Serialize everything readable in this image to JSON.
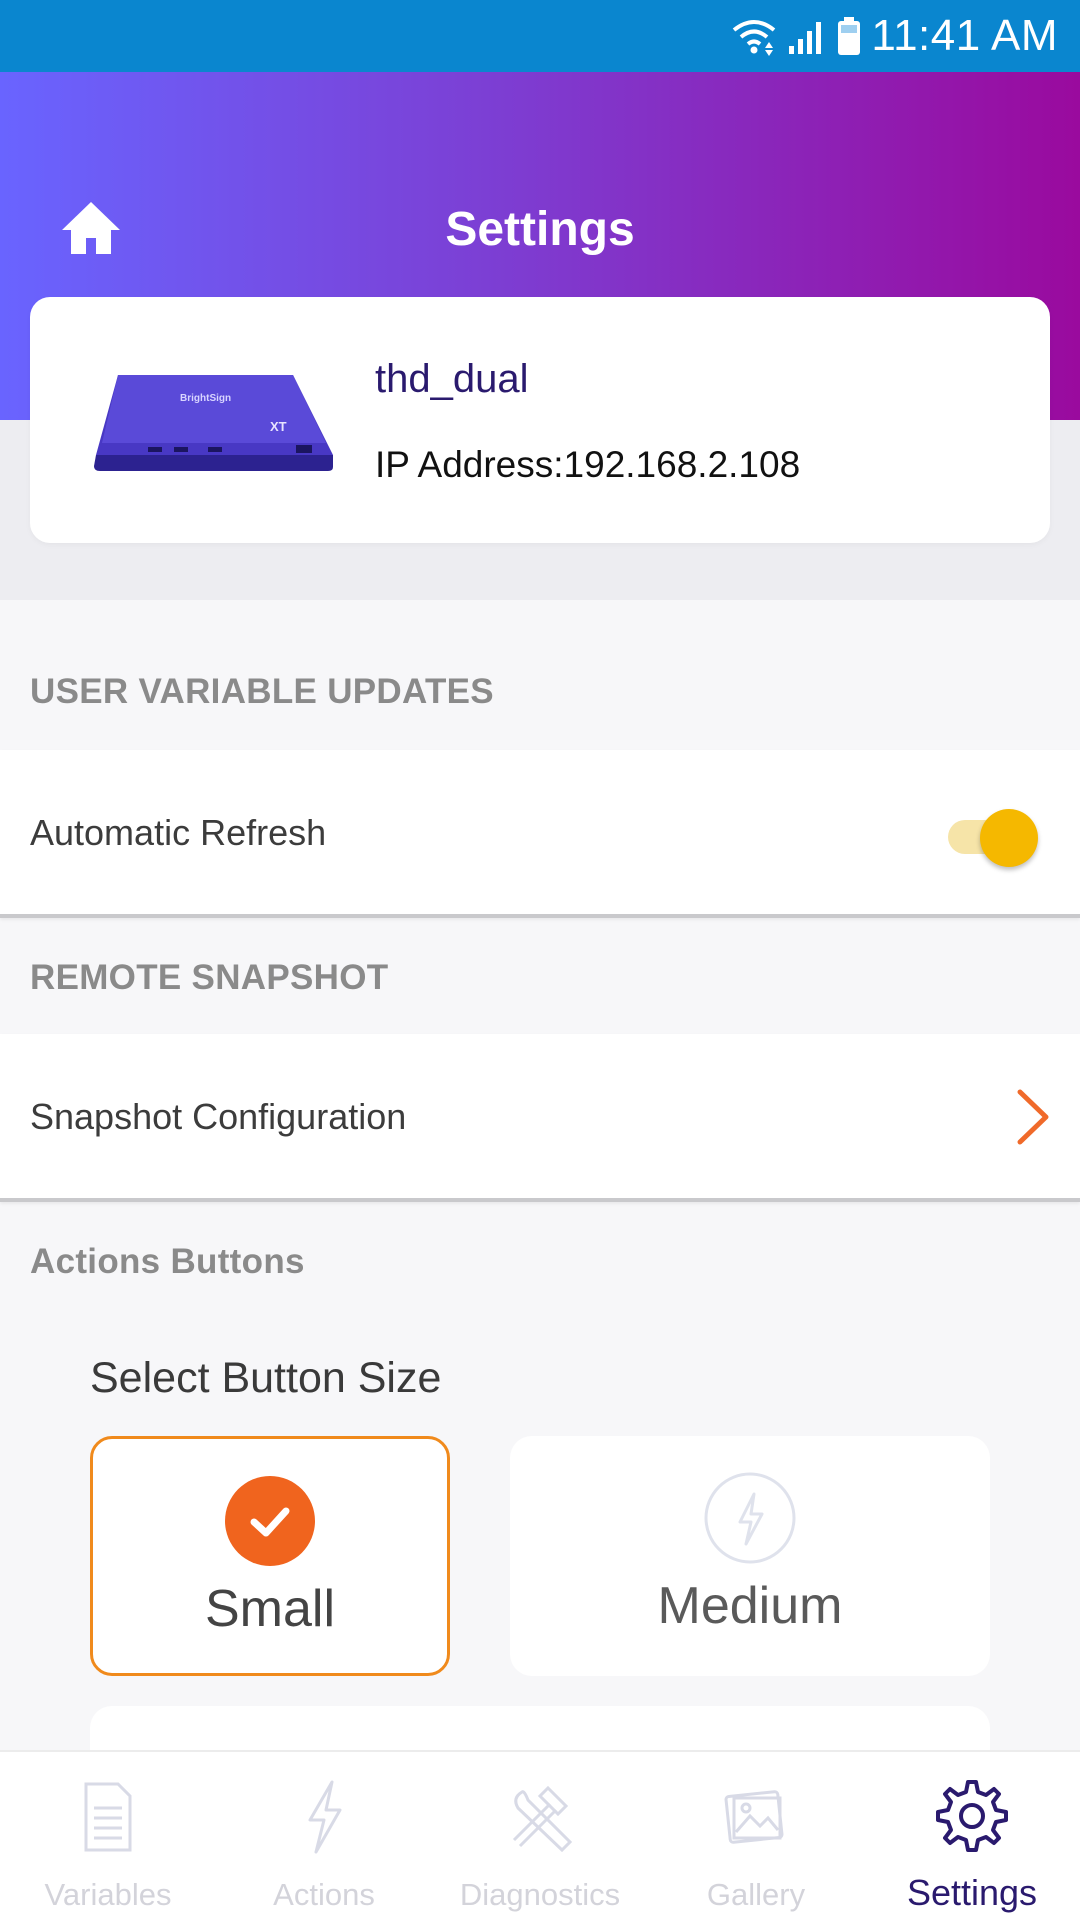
{
  "status_bar": {
    "time": "11:41 AM"
  },
  "header": {
    "title": "Settings"
  },
  "device": {
    "name": "thd_dual",
    "ip": "IP Address:192.168.2.108",
    "brand": "BrightSign",
    "model": "XT"
  },
  "sections": {
    "user_variable": {
      "title": "USER VARIABLE UPDATES",
      "row_label": "Automatic Refresh",
      "toggle_on": true
    },
    "remote_snapshot": {
      "title": "REMOTE SNAPSHOT",
      "row_label": "Snapshot Configuration"
    },
    "actions_buttons": {
      "title": "Actions Buttons",
      "select_title": "Select Button Size",
      "options": [
        {
          "label": "Small",
          "selected": true
        },
        {
          "label": "Medium",
          "selected": false
        }
      ]
    }
  },
  "bottom_nav": [
    {
      "label": "Variables",
      "icon": "document-icon",
      "active": false
    },
    {
      "label": "Actions",
      "icon": "lightning-icon",
      "active": false
    },
    {
      "label": "Diagnostics",
      "icon": "tools-icon",
      "active": false
    },
    {
      "label": "Gallery",
      "icon": "gallery-icon",
      "active": false
    },
    {
      "label": "Settings",
      "icon": "gear-icon",
      "active": true
    }
  ],
  "colors": {
    "status_bar": "#0a86cf",
    "header_gradient_start": "#6964ff",
    "header_gradient_end": "#9a0a9e",
    "accent_orange": "#f08a1c",
    "toggle_yellow": "#f5b800",
    "nav_active": "#2a1a6e"
  }
}
